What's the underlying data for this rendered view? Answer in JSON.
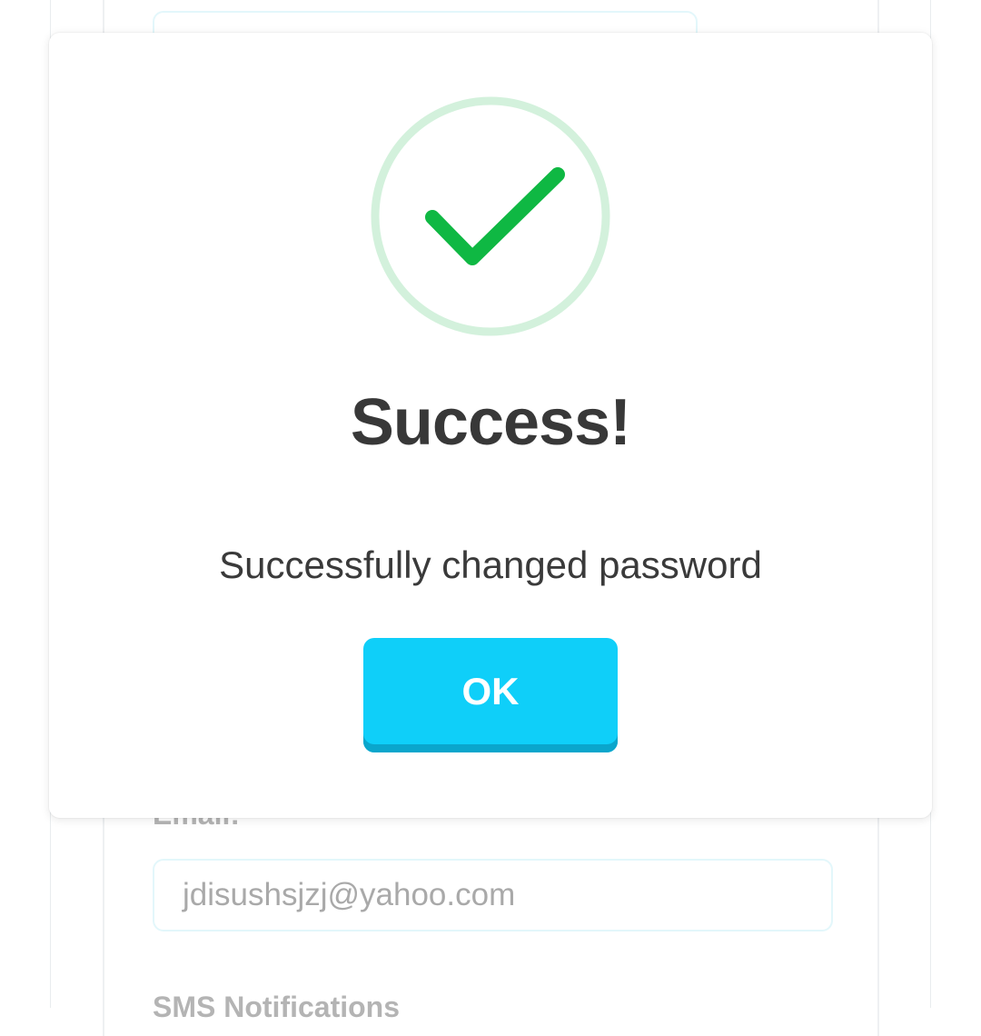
{
  "background": {
    "email_label": "Email:",
    "email_value": "jdisushsjzj@yahoo.com",
    "sms_label": "SMS Notifications"
  },
  "modal": {
    "icon": "check-circle-icon",
    "title": "Success!",
    "message": "Successfully changed password",
    "ok_label": "OK"
  },
  "colors": {
    "accent": "#0fcff9",
    "accent_shadow": "#0aa6cc",
    "success_green": "#0fb843",
    "success_ring": "#d3f1dc",
    "title_text": "#383838"
  }
}
